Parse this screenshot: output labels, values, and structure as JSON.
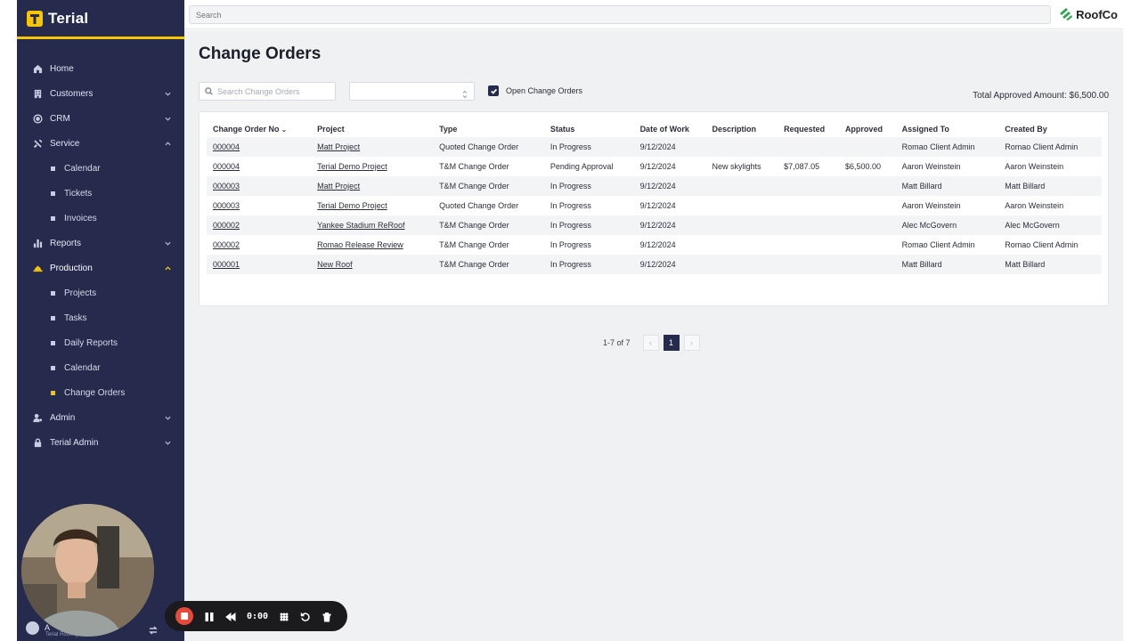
{
  "brand": {
    "name": "Terial"
  },
  "nav": {
    "home": "Home",
    "customers": "Customers",
    "crm": "CRM",
    "service": "Service",
    "service_items": [
      "Calendar",
      "Tickets",
      "Invoices"
    ],
    "reports": "Reports",
    "production": "Production",
    "production_items": [
      "Projects",
      "Tasks",
      "Daily Reports",
      "Calendar",
      "Change Orders"
    ],
    "admin": "Admin",
    "terial_admin": "Terial Admin"
  },
  "user": {
    "name": "A",
    "sub": "Terial Roofing"
  },
  "topbar": {
    "search_placeholder": "Search",
    "company": "RoofCo"
  },
  "page": {
    "title": "Change Orders",
    "search_placeholder": "Search Change Orders",
    "select_value": "",
    "checkbox_label": "Open Change Orders",
    "checkbox_checked": true,
    "total_approved": "Total Approved Amount: $6,500.00"
  },
  "table": {
    "headers": [
      "Change Order No",
      "Project",
      "Type",
      "Status",
      "Date of Work",
      "Description",
      "Requested",
      "Approved",
      "Assigned To",
      "Created By"
    ],
    "rows": [
      [
        "000004",
        "Matt Project",
        "Quoted Change Order",
        "In Progress",
        "9/12/2024",
        "",
        "",
        "",
        "Romao Client Admin",
        "Romao Client Admin"
      ],
      [
        "000004",
        "Terial Demo Project",
        "T&M Change Order",
        "Pending Approval",
        "9/12/2024",
        "New skylights",
        "$7,087.05",
        "$6,500.00",
        "Aaron Weinstein",
        "Aaron Weinstein"
      ],
      [
        "000003",
        "Matt Project",
        "T&M Change Order",
        "In Progress",
        "9/12/2024",
        "",
        "",
        "",
        "Matt Billard",
        "Matt Billard"
      ],
      [
        "000003",
        "Terial Demo Project",
        "Quoted Change Order",
        "In Progress",
        "9/12/2024",
        "",
        "",
        "",
        "Aaron Weinstein",
        "Aaron Weinstein"
      ],
      [
        "000002",
        "Yankee Stadium ReRoof",
        "T&M Change Order",
        "In Progress",
        "9/12/2024",
        "",
        "",
        "",
        "Alec McGovern",
        "Alec McGovern"
      ],
      [
        "000002",
        "Romao Release Review",
        "T&M Change Order",
        "In Progress",
        "9/12/2024",
        "",
        "",
        "",
        "Romao Client Admin",
        "Romao Client Admin"
      ],
      [
        "000001",
        "New Roof",
        "T&M Change Order",
        "In Progress",
        "9/12/2024",
        "",
        "",
        "",
        "Matt Billard",
        "Matt Billard"
      ]
    ]
  },
  "pager": {
    "count": "1-7 of 7",
    "prev": "‹",
    "page": "1",
    "next": "›"
  },
  "recorder": {
    "time": "0:00"
  },
  "colors": {
    "sidebar": "#262b4e",
    "accent": "#f7c600",
    "record": "#e8493d"
  }
}
